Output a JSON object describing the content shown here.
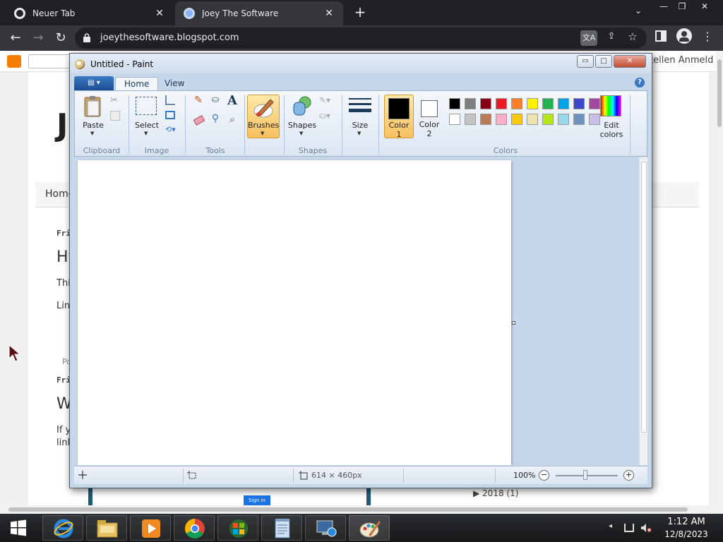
{
  "browser": {
    "tabs": [
      {
        "title": "Neuer Tab",
        "close": "✕"
      },
      {
        "title": "Joey The Software",
        "close": "✕"
      }
    ],
    "new_tab": "+",
    "tab_search": "⌄",
    "window_controls": {
      "minimize": "—",
      "restore": "❐",
      "close": "✕"
    },
    "nav": {
      "back": "←",
      "forward": "→",
      "reload": "↻"
    },
    "url": "joeythesoftware.blogspot.com",
    "translate_label": "文A",
    "share_glyph": "⇪",
    "star_glyph": "☆",
    "menu_glyph": "⋮"
  },
  "blog": {
    "top_actions": "tellen   Anmeld",
    "title_fragment": "J",
    "nav_home": "Home",
    "posts": [
      {
        "date": "Frid",
        "title": "Hy",
        "line1": "This",
        "line2": "Link"
      },
      {
        "date": "Frid",
        "title": "Wh",
        "line1": "If yo",
        "line2": "link"
      }
    ],
    "post_footer": "Pos",
    "image_signin": "Sign in",
    "archive": "▶  2018 (1)"
  },
  "paint": {
    "title": "Untitled - Paint",
    "titlebar_buttons": {
      "minimize": "▭",
      "maximize": "□",
      "close": "✕"
    },
    "menu_button": "▤ ▾",
    "tabs": [
      "Home",
      "View"
    ],
    "help": "?",
    "groups": {
      "clipboard": "Clipboard",
      "image": "Image",
      "tools": "Tools",
      "shapes": "Shapes",
      "colors": "Colors"
    },
    "buttons": {
      "paste": "Paste",
      "select": "Select",
      "brushes": "Brushes",
      "shapes": "Shapes",
      "size": "Size",
      "color1_line1": "Color",
      "color1_line2": "1",
      "color2_line1": "Color",
      "color2_line2": "2",
      "edit_colors_line1": "Edit",
      "edit_colors_line2": "colors"
    },
    "color1": "#000000",
    "color2": "#ffffff",
    "palette_row1": [
      "#000000",
      "#7f7f7f",
      "#880015",
      "#ed1c24",
      "#ff7f27",
      "#fff200",
      "#22b14c",
      "#00a2e8",
      "#3f48cc",
      "#a349a4"
    ],
    "palette_row2": [
      "#ffffff",
      "#c3c3c3",
      "#b97a57",
      "#ffaec9",
      "#ffc90e",
      "#efe4b0",
      "#b5e61d",
      "#99d9ea",
      "#7092be",
      "#c8bfe7"
    ],
    "status": {
      "image_size": "614 × 460px",
      "zoom": "100%",
      "zoom_out": "−",
      "zoom_in": "+"
    }
  },
  "taskbar": {
    "time": "1:12 AM",
    "date": "12/8/2023",
    "tray_arrow": "◂"
  }
}
